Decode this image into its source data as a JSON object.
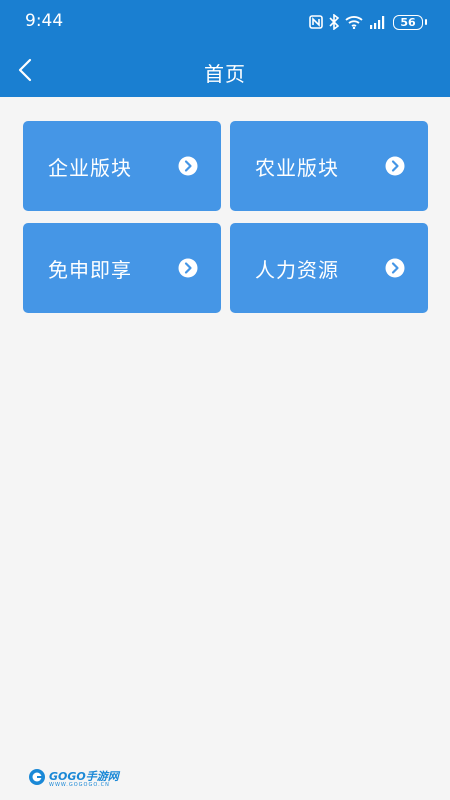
{
  "status_bar": {
    "time": "9:44",
    "battery": "56",
    "icons": [
      "nfc-icon",
      "bluetooth-icon",
      "wifi-icon",
      "signal-icon",
      "battery-icon"
    ]
  },
  "app_bar": {
    "title": "首页",
    "back_icon": "back-arrow-icon"
  },
  "menu": {
    "items": [
      {
        "label": "企业版块",
        "icon": "chevron-right-circle-icon"
      },
      {
        "label": "农业版块",
        "icon": "chevron-right-circle-icon"
      },
      {
        "label": "免申即享",
        "icon": "chevron-right-circle-icon"
      },
      {
        "label": "人力资源",
        "icon": "chevron-right-circle-icon"
      }
    ]
  },
  "watermark": {
    "brand": "GOGO手游网",
    "url": "WWW.GOGOGO.CN"
  },
  "colors": {
    "primary": "#1a7fd1",
    "card": "#4596e6",
    "background": "#f5f5f5"
  }
}
